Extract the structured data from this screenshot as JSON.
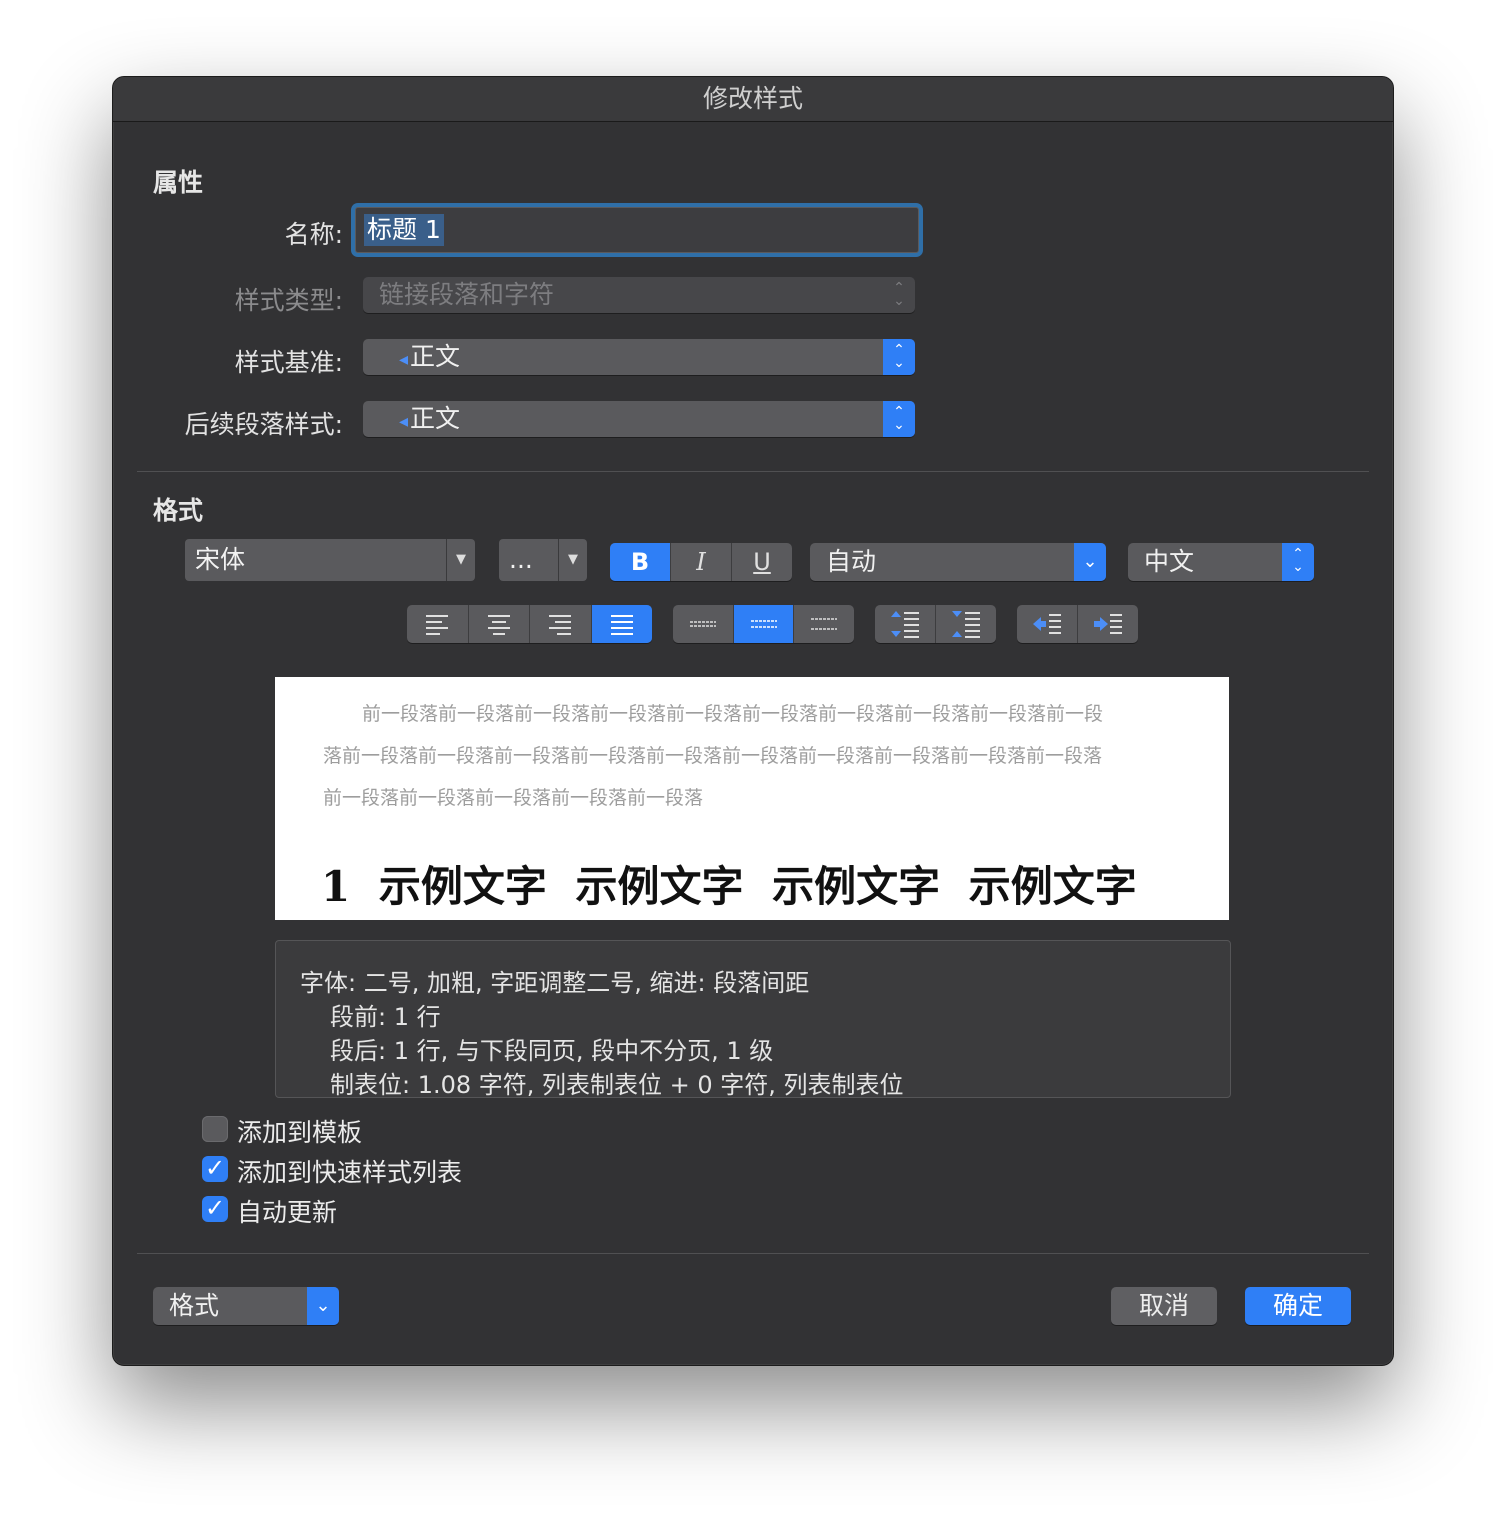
{
  "window": {
    "title": "修改样式"
  },
  "properties": {
    "heading": "属性",
    "name_label": "名称:",
    "name_value": "标题 1",
    "style_type_label": "样式类型:",
    "style_type_value": "链接段落和字符",
    "based_on_label": "样式基准:",
    "based_on_value": "正文",
    "next_style_label": "后续段落样式:",
    "next_style_value": "正文"
  },
  "format": {
    "heading": "格式",
    "font_value": "宋体",
    "size_value": "...",
    "bold_label": "B",
    "italic_label": "I",
    "underline_label": "U",
    "color_value": "自动",
    "language_value": "中文",
    "alignment_selected": "justify",
    "line_spacing_selected": "1.5",
    "accent_color": "#2f7ff6"
  },
  "preview": {
    "prev_lines": [
      "前一段落前一段落前一段落前一段落前一段落前一段落前一段落前一段落前一段落前一段",
      "落前一段落前一段落前一段落前一段落前一段落前一段落前一段落前一段落前一段落前一段落",
      "前一段落前一段落前一段落前一段落前一段落"
    ],
    "sample": "1 示例文字 示例文字 示例文字 示例文字"
  },
  "description": {
    "lines": [
      "字体: 二号, 加粗, 字距调整二号, 缩进: 段落间距",
      "段前: 1 行",
      "段后: 1 行, 与下段同页, 段中不分页, 1 级",
      "制表位: 1.08 字符, 列表制表位 + 0 字符, 列表制表位"
    ]
  },
  "options": {
    "add_to_template_label": "添加到模板",
    "add_to_template_checked": false,
    "add_to_quick_styles_label": "添加到快速样式列表",
    "add_to_quick_styles_checked": true,
    "auto_update_label": "自动更新",
    "auto_update_checked": true
  },
  "footer": {
    "format_menu_label": "格式",
    "cancel_label": "取消",
    "ok_label": "确定"
  }
}
